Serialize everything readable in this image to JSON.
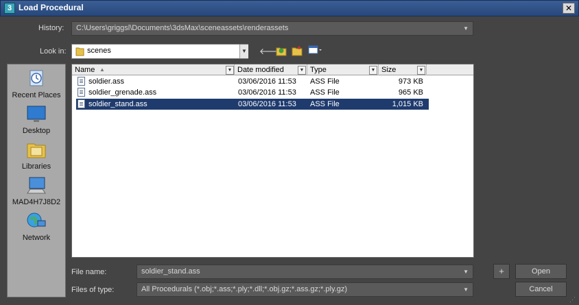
{
  "window": {
    "title": "Load Procedural",
    "app_icon_glyph": "3",
    "close_glyph": "✕"
  },
  "history": {
    "label": "History:",
    "value": "C:\\Users\\griggsl\\Documents\\3dsMax\\sceneassets\\renderassets"
  },
  "look_in": {
    "label": "Look in:",
    "value": "scenes",
    "tools": [
      "back-arrow-icon",
      "up-folder-icon",
      "new-folder-icon",
      "view-menu-icon"
    ]
  },
  "places": [
    {
      "label": "Recent Places",
      "icon": "recent-places-icon"
    },
    {
      "label": "Desktop",
      "icon": "desktop-icon"
    },
    {
      "label": "Libraries",
      "icon": "libraries-icon"
    },
    {
      "label": "MAD4H7J8D2",
      "icon": "computer-icon"
    },
    {
      "label": "Network",
      "icon": "network-icon"
    }
  ],
  "columns": [
    "Name",
    "Date modified",
    "Type",
    "Size"
  ],
  "files": [
    {
      "name": "soldier.ass",
      "date": "03/06/2016 11:53",
      "type": "ASS File",
      "size": "973 KB",
      "selected": false
    },
    {
      "name": "soldier_grenade.ass",
      "date": "03/06/2016 11:53",
      "type": "ASS File",
      "size": "965 KB",
      "selected": false
    },
    {
      "name": "soldier_stand.ass",
      "date": "03/06/2016 11:53",
      "type": "ASS File",
      "size": "1,015 KB",
      "selected": true
    }
  ],
  "file_name": {
    "label": "File name:",
    "value": "soldier_stand.ass"
  },
  "files_of_type": {
    "label": "Files of type:",
    "value": "All Procedurals (*.obj;*.ass;*.ply;*.dll;*.obj.gz;*.ass.gz;*.ply.gz)"
  },
  "buttons": {
    "plus": "+",
    "open": "Open",
    "cancel": "Cancel"
  },
  "colors": {
    "background": "#444444",
    "title_bar": "#2f5286",
    "selection": "#1f3b6e"
  }
}
